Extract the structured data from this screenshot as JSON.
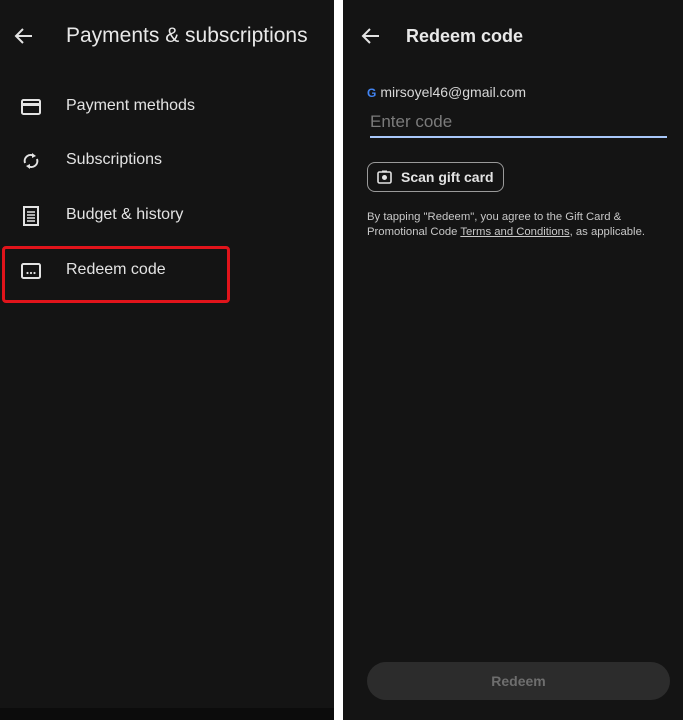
{
  "left": {
    "title": "Payments & subscriptions",
    "items": [
      {
        "label": "Payment methods",
        "icon": "credit-card-icon"
      },
      {
        "label": "Subscriptions",
        "icon": "sync-icon"
      },
      {
        "label": "Budget & history",
        "icon": "receipt-icon"
      },
      {
        "label": "Redeem code",
        "icon": "redeem-code-icon",
        "highlighted": true
      }
    ],
    "highlight_color": "#e0141b"
  },
  "right": {
    "title": "Redeem code",
    "account_email": "mirsoyel46@gmail.com",
    "code_input": {
      "value": "",
      "placeholder": "Enter code"
    },
    "scan_button": "Scan gift card",
    "terms_prefix": "By tapping \"Redeem\", you agree to the Gift Card & Promotional Code ",
    "terms_link": "Terms and Conditions",
    "terms_suffix": ", as applicable.",
    "redeem_button": "Redeem",
    "accent_color": "#a8c7fa"
  }
}
